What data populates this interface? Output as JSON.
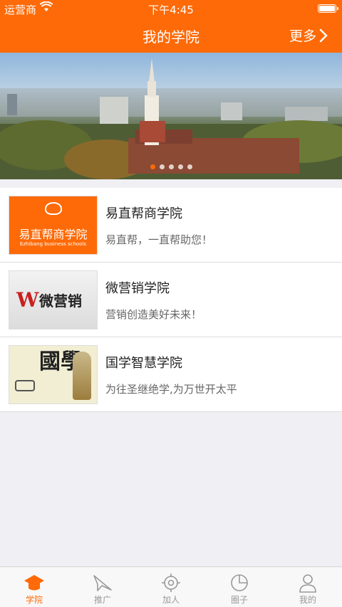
{
  "status_bar": {
    "carrier": "运营商",
    "time": "下午4:45"
  },
  "navbar": {
    "title": "我的学院",
    "more": "更多"
  },
  "banner": {
    "dots": 5,
    "active_dot": 1
  },
  "colors": {
    "accent": "#fe6a07"
  },
  "schools": [
    {
      "name": "易直帮商学院",
      "desc": "易直帮，一直帮助您！",
      "thumb": {
        "text": "易直帮商学院",
        "subtext": "Ezhibang business schools"
      }
    },
    {
      "name": "微营销学院",
      "desc": "营销创造美好未来！",
      "thumb": {
        "text": "微营销"
      }
    },
    {
      "name": "国学智慧学院",
      "desc": "为往圣继绝学,为万世开太平",
      "thumb": {
        "text": "國學"
      }
    }
  ],
  "tabs": [
    {
      "label": "学院",
      "icon": "graduation-cap-icon",
      "active": true
    },
    {
      "label": "推广",
      "icon": "paper-plane-icon",
      "active": false
    },
    {
      "label": "加人",
      "icon": "crosshair-icon",
      "active": false
    },
    {
      "label": "圈子",
      "icon": "pie-chart-icon",
      "active": false
    },
    {
      "label": "我的",
      "icon": "user-icon",
      "active": false
    }
  ]
}
